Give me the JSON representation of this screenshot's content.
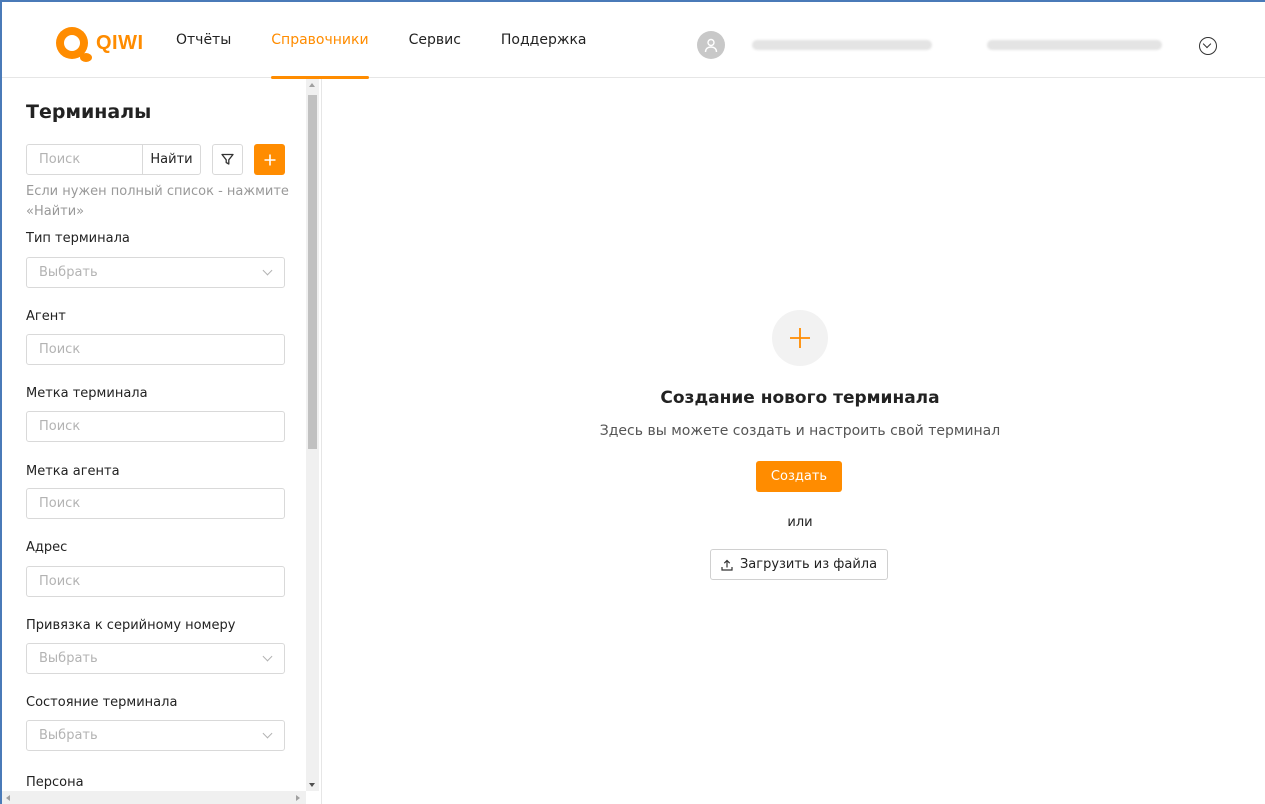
{
  "header": {
    "logo_text": "QIWI",
    "nav": [
      {
        "label": "Отчёты",
        "active": false
      },
      {
        "label": "Справочники",
        "active": true
      },
      {
        "label": "Сервис",
        "active": false
      },
      {
        "label": "Поддержка",
        "active": false
      }
    ],
    "icons": {
      "avatar": "user-icon",
      "menu": "chevron-down-circle-icon"
    }
  },
  "sidebar": {
    "title": "Терминалы",
    "search": {
      "placeholder": "Поиск",
      "button": "Найти"
    },
    "hint": "Если нужен полный список - нажмите «Найти»",
    "fields": [
      {
        "label": "Тип терминала",
        "placeholder": "Выбрать",
        "kind": "select"
      },
      {
        "label": "Агент",
        "placeholder": "Поиск",
        "kind": "input"
      },
      {
        "label": "Метка терминала",
        "placeholder": "Поиск",
        "kind": "input"
      },
      {
        "label": "Метка агента",
        "placeholder": "Поиск",
        "kind": "input"
      },
      {
        "label": "Адрес",
        "placeholder": "Поиск",
        "kind": "input"
      },
      {
        "label": "Привязка к серийному номеру",
        "placeholder": "Выбрать",
        "kind": "select"
      },
      {
        "label": "Состояние терминала",
        "placeholder": "Выбрать",
        "kind": "select"
      },
      {
        "label": "Персона",
        "placeholder": "",
        "kind": "label"
      }
    ]
  },
  "main": {
    "title": "Создание нового терминала",
    "subtitle": "Здесь вы можете создать и настроить свой терминал",
    "create_button": "Создать",
    "or": "или",
    "upload_button": "Загрузить из файла"
  },
  "colors": {
    "accent": "#ff8c00",
    "border": "#d9d9d9",
    "muted": "#999999"
  }
}
